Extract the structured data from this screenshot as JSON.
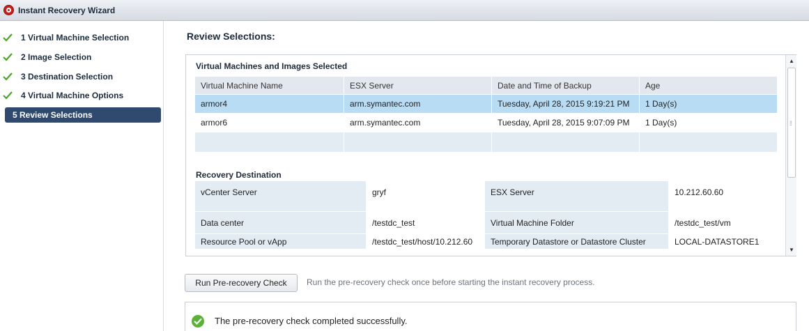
{
  "window": {
    "title": "Instant Recovery Wizard"
  },
  "steps": [
    {
      "label": "1  Virtual Machine Selection",
      "done": true
    },
    {
      "label": "2  Image Selection",
      "done": true
    },
    {
      "label": "3  Destination Selection",
      "done": true
    },
    {
      "label": "4  Virtual Machine Options",
      "done": true
    },
    {
      "label": "5  Review Selections",
      "active": true
    }
  ],
  "review": {
    "title": "Review Selections:",
    "vm_section_title": "Virtual Machines and Images Selected",
    "vm_columns": [
      "Virtual Machine Name",
      "ESX Server",
      "Date and Time of Backup",
      "Age"
    ],
    "vm_rows": [
      [
        "armor4",
        "arm.symantec.com",
        "Tuesday, April 28, 2015 9:19:21 PM",
        "1 Day(s)"
      ],
      [
        "armor6",
        "arm.symantec.com",
        "Tuesday, April 28, 2015 9:07:09 PM",
        "1 Day(s)"
      ]
    ],
    "dest_section_title": "Recovery Destination",
    "dest_rows": [
      [
        "vCenter Server",
        "gryf",
        "ESX Server",
        "10.212.60.60"
      ],
      [
        "Data center",
        "/testdc_test",
        "Virtual Machine Folder",
        "/testdc_test/vm"
      ],
      [
        "Resource Pool or vApp",
        "/testdc_test/host/10.212.60",
        "Temporary Datastore or Datastore Cluster",
        "LOCAL-DATASTORE1"
      ]
    ]
  },
  "precheck": {
    "button_label": "Run Pre-recovery Check",
    "hint": "Run the pre-recovery check once before starting the instant recovery process.",
    "result": "The pre-recovery check completed successfully."
  },
  "colors": {
    "accent": "#2f4a6e",
    "selected_row": "#b9dcf5",
    "success": "#5cb13a",
    "check": "#4ea32a"
  },
  "icons": {
    "title": "wizard-app-icon",
    "step_done": "checkmark-icon",
    "result": "success-check-icon"
  }
}
